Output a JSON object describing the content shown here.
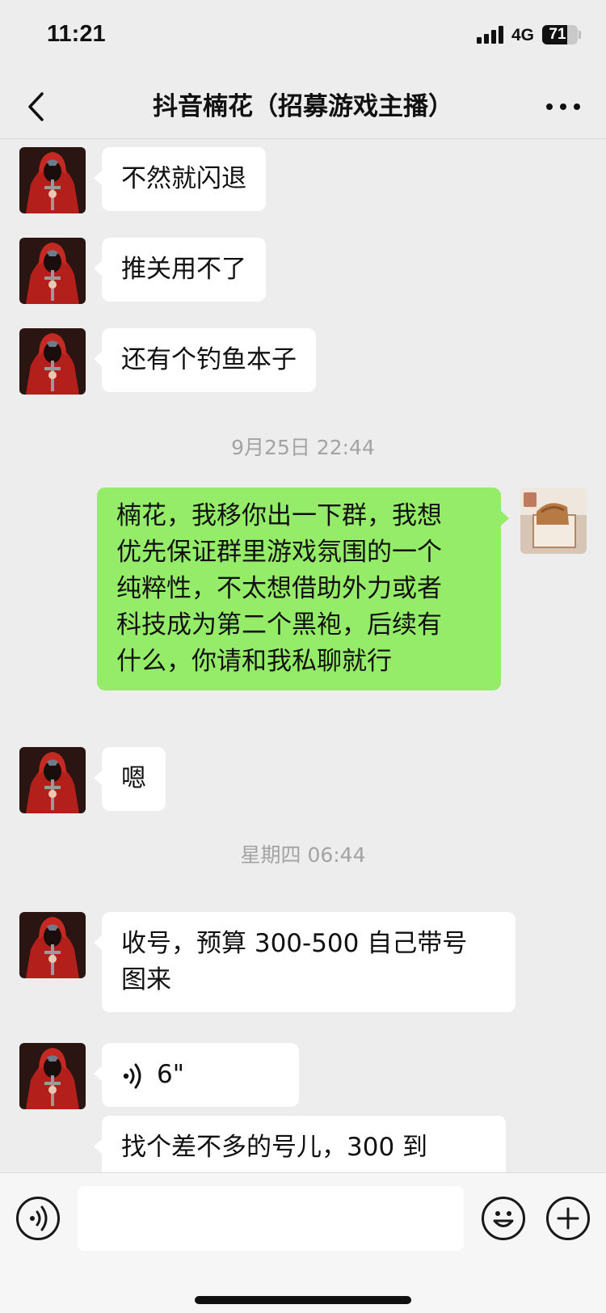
{
  "status_bar": {
    "time": "11:21",
    "network": "4G",
    "battery": "71",
    "battery_level": 0.71
  },
  "nav": {
    "title": "抖音楠花（招募游戏主播）",
    "back_icon": "chevron-left-icon",
    "more_icon": "more-dots-icon"
  },
  "messages": [
    {
      "side": "left",
      "text": "不然就闪退"
    },
    {
      "side": "left",
      "text": "推关用不了"
    },
    {
      "side": "left",
      "text": "还有个钓鱼本子"
    },
    {
      "timestamp": "9月25日 22:44"
    },
    {
      "side": "right",
      "lines": [
        "楠花，我移你出一下群，我想",
        "优先保证群里游戏氛围的一个",
        "纯粹性，不太想借助外力或者",
        "科技成为第二个黑袍，后续有",
        "什么，你请和我私聊就行"
      ]
    },
    {
      "side": "left",
      "text": "嗯"
    },
    {
      "timestamp": "星期四 06:44"
    },
    {
      "side": "left",
      "lines": [
        "收号，预算 300-500 自己带号",
        "图来"
      ]
    },
    {
      "side": "left",
      "voice_duration": "6\""
    },
    {
      "side": "left",
      "lines": [
        "找个差不多的号儿，300 到"
      ]
    }
  ],
  "input_bar": {
    "voice_icon": "voice-icon",
    "emoji_icon": "emoji-icon",
    "plus_icon": "plus-icon"
  },
  "colors": {
    "background": "#ededed",
    "bubble_left": "#ffffff",
    "bubble_right": "#95ec69",
    "avatar_red": "#b3201c"
  }
}
